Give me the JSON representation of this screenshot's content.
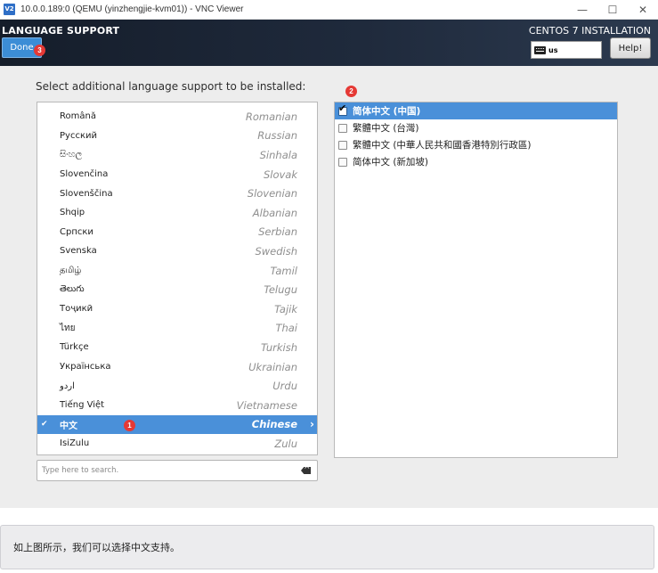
{
  "window": {
    "logo_text": "V2",
    "title": "10.0.0.189:0 (QEMU (yinzhengjie-kvm01)) - VNC Viewer",
    "minimize_glyph": "—",
    "maximize_glyph": "☐",
    "close_glyph": "✕"
  },
  "header": {
    "title": "LANGUAGE SUPPORT",
    "done_label": "Done",
    "product": "CENTOS 7 INSTALLATION",
    "keyboard_layout": "us",
    "help_label": "Help!"
  },
  "badges": [
    "1",
    "2",
    "3"
  ],
  "prompt": "Select additional language support to be installed:",
  "languages": [
    {
      "native": "Română",
      "english": "Romanian"
    },
    {
      "native": "Русский",
      "english": "Russian"
    },
    {
      "native": "සිංහල",
      "english": "Sinhala"
    },
    {
      "native": "Slovenčina",
      "english": "Slovak"
    },
    {
      "native": "Slovenščina",
      "english": "Slovenian"
    },
    {
      "native": "Shqip",
      "english": "Albanian"
    },
    {
      "native": "Српски",
      "english": "Serbian"
    },
    {
      "native": "Svenska",
      "english": "Swedish"
    },
    {
      "native": "தமிழ்",
      "english": "Tamil"
    },
    {
      "native": "తెలుగు",
      "english": "Telugu"
    },
    {
      "native": "Тоҷикӣ",
      "english": "Tajik"
    },
    {
      "native": "ไทย",
      "english": "Thai"
    },
    {
      "native": "Türkçe",
      "english": "Turkish"
    },
    {
      "native": "Українська",
      "english": "Ukrainian"
    },
    {
      "native": "اردو",
      "english": "Urdu"
    },
    {
      "native": "Tiếng Việt",
      "english": "Vietnamese"
    },
    {
      "native": "中文",
      "english": "Chinese",
      "selected": true
    },
    {
      "native": "IsiZulu",
      "english": "Zulu"
    }
  ],
  "selected_check": "✔",
  "selected_chevron": "›",
  "search": {
    "placeholder": "Type here to search.",
    "value": ""
  },
  "locales": [
    {
      "label": "简体中文 (中国)",
      "checked": true,
      "selected": true
    },
    {
      "label": "繁體中文 (台灣)",
      "checked": false,
      "selected": false
    },
    {
      "label": "繁體中文 (中華人民共和國香港特別行政區)",
      "checked": false,
      "selected": false
    },
    {
      "label": "简体中文 (新加坡)",
      "checked": false,
      "selected": false
    }
  ],
  "checkbox_glyph": "✔",
  "caption": "如上图所示，我们可以选择中文支持。",
  "colors": {
    "selection": "#4a90d9",
    "header_dark": "#151d2a",
    "done_button": "#3c8dd6",
    "badge": "#e53935"
  }
}
